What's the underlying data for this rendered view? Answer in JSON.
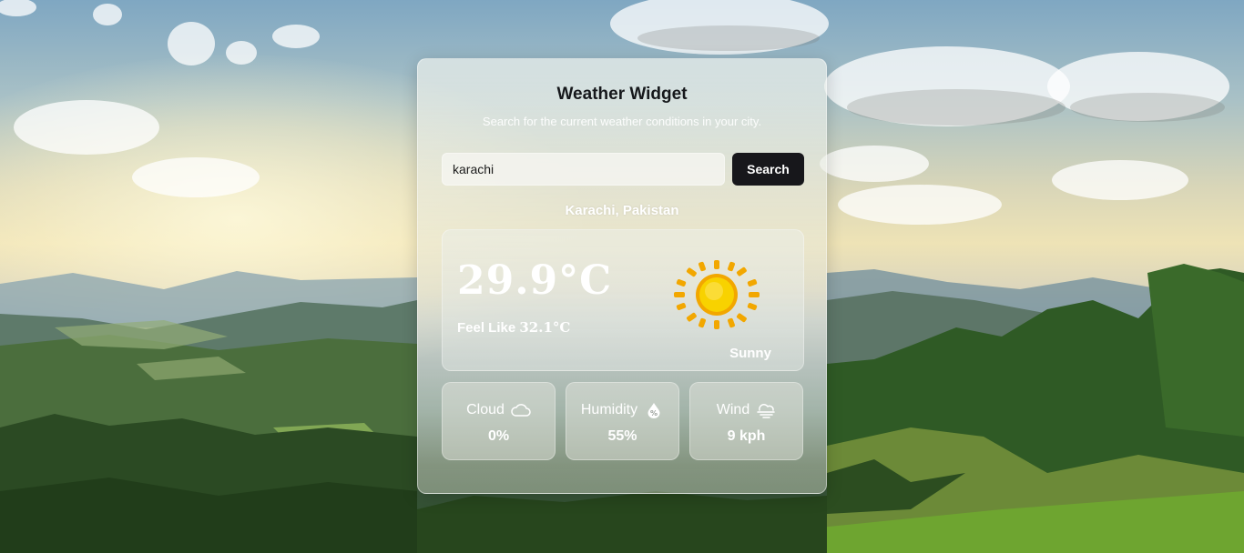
{
  "widget": {
    "title": "Weather Widget",
    "subtitle": "Search for the current weather conditions in your city.",
    "search": {
      "value": "karachi",
      "button_label": "Search"
    },
    "location": "Karachi, Pakistan",
    "current": {
      "temperature": "29.9°C",
      "feels_like_label": "Feel Like",
      "feels_like_value": "32.1°C",
      "condition": "Sunny",
      "condition_icon": "sun-icon"
    },
    "stats": [
      {
        "label": "Cloud",
        "value": "0%",
        "icon": "cloud-icon"
      },
      {
        "label": "Humidity",
        "value": "55%",
        "icon": "humidity-drop-icon"
      },
      {
        "label": "Wind",
        "value": "9 kph",
        "icon": "wind-icon"
      }
    ]
  },
  "colors": {
    "button_bg": "#17171b",
    "sun_core": "#f5c400",
    "sun_rays": "#f2a700"
  }
}
